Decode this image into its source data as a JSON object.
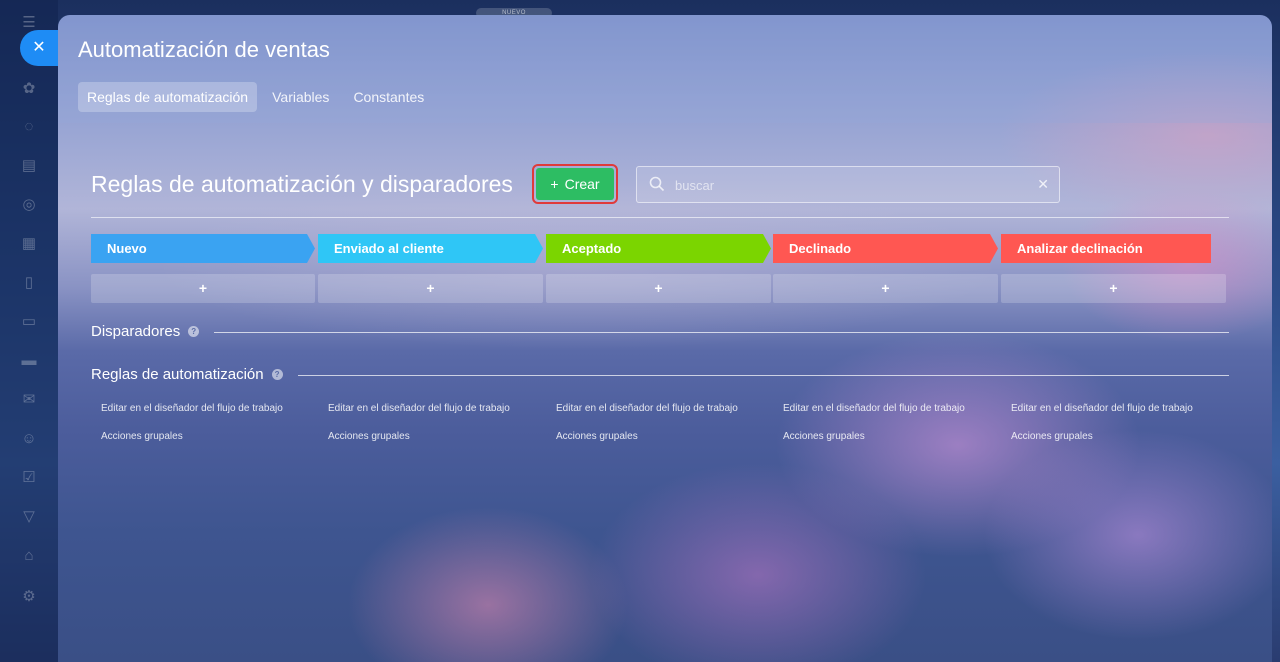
{
  "top_badge": "NUEVO",
  "app_title": "Automatización de ventas",
  "tabs": [
    {
      "label": "Reglas de automatización",
      "active": true
    },
    {
      "label": "Variables",
      "active": false
    },
    {
      "label": "Constantes",
      "active": false
    }
  ],
  "section_title": "Reglas de automatización y disparadores",
  "create_button": "Crear",
  "search": {
    "placeholder": "buscar",
    "value": ""
  },
  "stages": [
    {
      "label": "Nuevo",
      "color": "#3aa3f2"
    },
    {
      "label": "Enviado al cliente",
      "color": "#2fc6f6"
    },
    {
      "label": "Aceptado",
      "color": "#7bd500"
    },
    {
      "label": "Declinado",
      "color": "#ff5752"
    },
    {
      "label": "Analizar declinación",
      "color": "#ff5752"
    }
  ],
  "add_symbol": "+",
  "triggers_label": "Disparadores",
  "rules_label": "Reglas de automatización",
  "column_links": {
    "edit": "Editar en el diseñador del flujo de trabajo",
    "group": "Acciones grupales"
  },
  "icons": {
    "close": "close-icon",
    "search": "search-icon",
    "clear": "clear-icon",
    "help": "help-icon"
  }
}
